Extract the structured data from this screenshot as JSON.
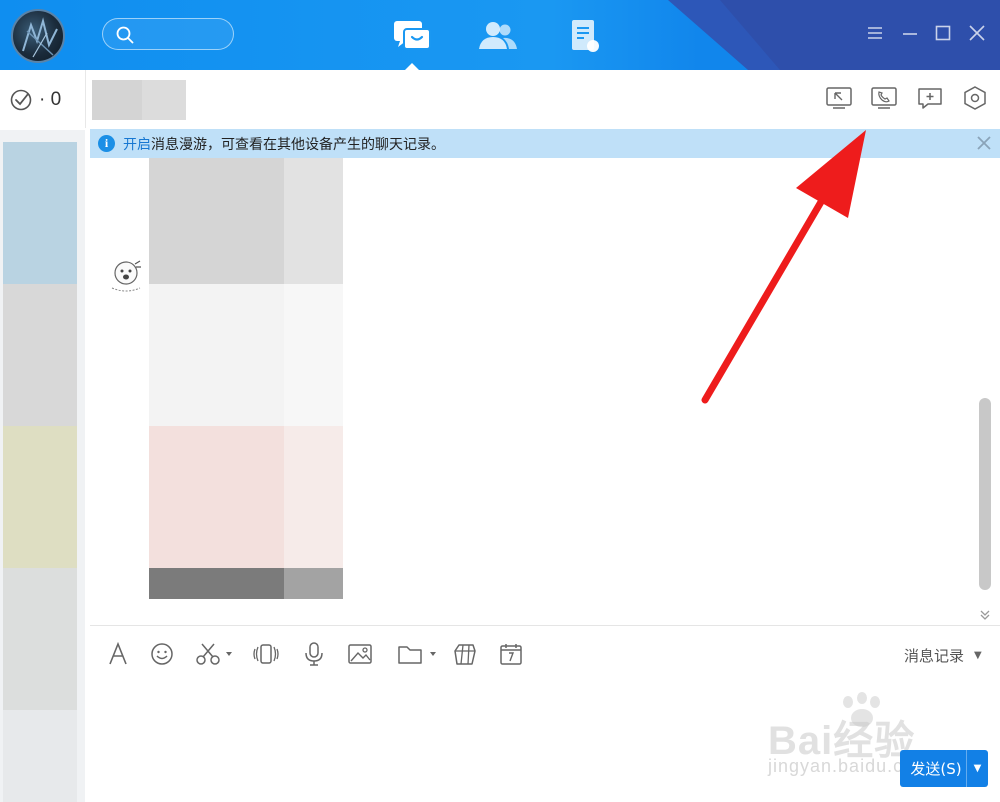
{
  "counter": {
    "value": "· 0"
  },
  "notice": {
    "link_text": "开启",
    "text": "消息漫游，可查看在其他设备产生的聊天记录。"
  },
  "toolbar": {
    "history_label": "消息记录"
  },
  "send": {
    "label": "发送(S)"
  },
  "watermark": {
    "line1": "Bai经验",
    "line2": "jingyan.baidu.com"
  },
  "colors": {
    "topbar": "#1a98f2",
    "accent": "#1280e6",
    "notice_bg": "#bfe0f8",
    "annotation": "#ee1c1c"
  }
}
